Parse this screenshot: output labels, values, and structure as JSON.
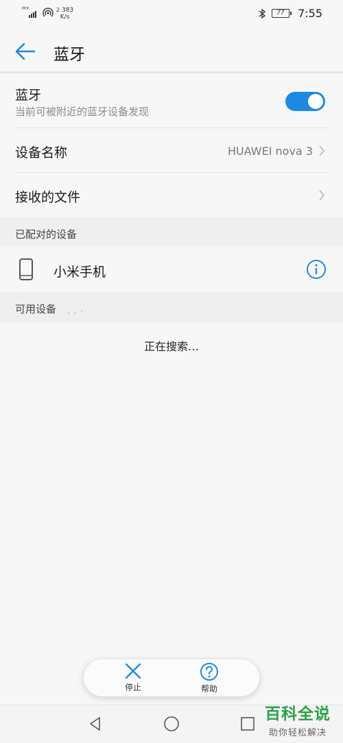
{
  "statusbar": {
    "net_type": "H+",
    "net_speed_superscript": "2",
    "net_speed_value": "383",
    "net_speed_unit": "K/s",
    "battery": "77",
    "time": "7:55"
  },
  "appbar": {
    "title": "蓝牙",
    "back_icon": "arrow-left-icon"
  },
  "bluetooth": {
    "label": "蓝牙",
    "subtitle": "当前可被附近的蓝牙设备发现",
    "enabled": true,
    "accent": "#1e88e5"
  },
  "device_name": {
    "label": "设备名称",
    "value": "HUAWEI nova 3"
  },
  "received_files": {
    "label": "接收的文件"
  },
  "paired_section": {
    "label": "已配对的设备"
  },
  "paired_devices": [
    {
      "name": "小米手机",
      "icon": "phone-icon"
    }
  ],
  "available_section": {
    "label": "可用设备"
  },
  "searching_text": "正在搜索…",
  "actions": {
    "stop": "停止",
    "help": "帮助"
  },
  "watermark": {
    "brand": "百科全说",
    "tagline": "助你轻松解决"
  }
}
